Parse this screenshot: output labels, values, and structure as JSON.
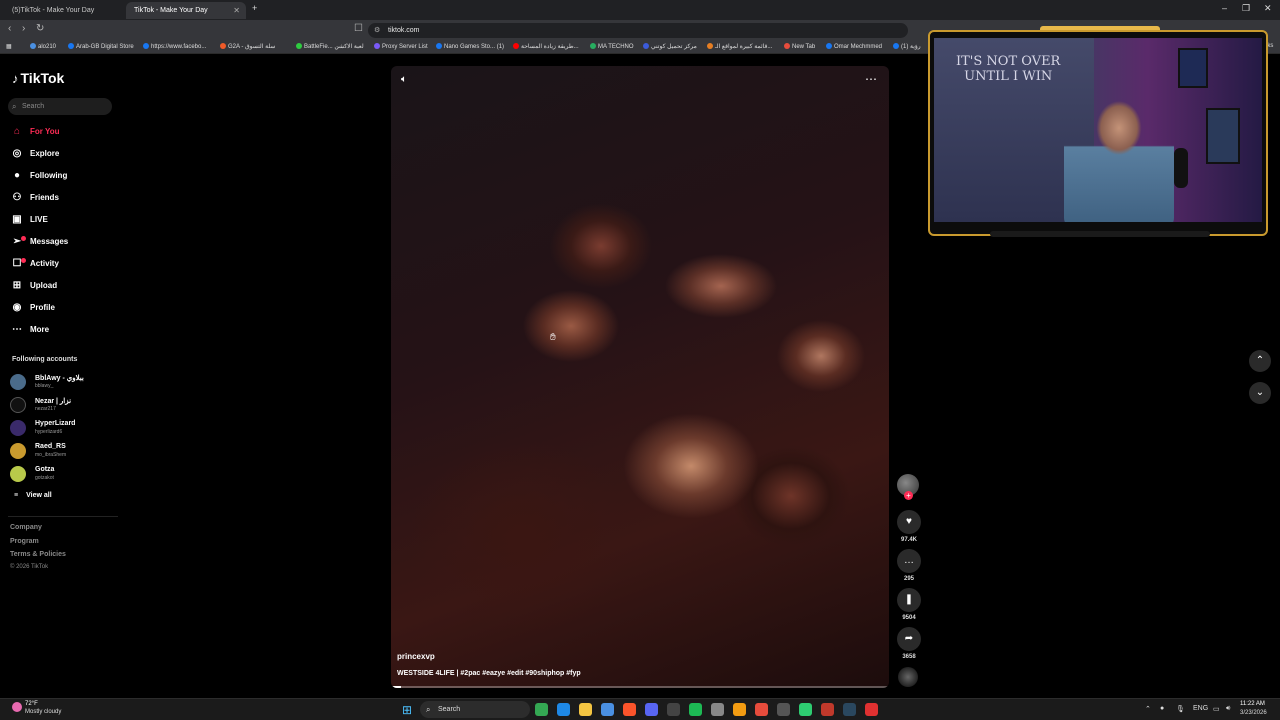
{
  "browser": {
    "tabs": [
      {
        "label": "(5)TikTok - Make Your Day"
      },
      {
        "label": "TikTok - Make Your Day"
      }
    ],
    "new_tab_symbol": "+",
    "url": "tiktok.com",
    "bookmarks": [
      {
        "label": "alo210",
        "color": "#4a90e2"
      },
      {
        "label": "Arab-GB Digital Store",
        "color": "#1877f2"
      },
      {
        "label": "https://www.facebo...",
        "color": "#1877f2"
      },
      {
        "label": "G2A - سلة التسوق",
        "color": "#f05a28"
      },
      {
        "label": "BattleFie... لعبة الاكشن",
        "color": "#2ecc40"
      },
      {
        "label": "Proxy Server List",
        "color": "#7a5af8"
      },
      {
        "label": "Nano Games Sto... (1)",
        "color": "#1877f2"
      },
      {
        "label": "طريقة زيادة المساحة...",
        "color": "#ff0000"
      },
      {
        "label": "MA TECHNO",
        "color": "#27ae60"
      },
      {
        "label": "مركز تحميل كوتني",
        "color": "#3b5bdb"
      },
      {
        "label": "قائمة كبيرة لمواقع الـ...",
        "color": "#e67e22"
      },
      {
        "label": "New Tab",
        "color": "#e74c3c"
      },
      {
        "label": "Omar Mechmmed",
        "color": "#1877f2"
      },
      {
        "label": "(1) رؤية",
        "color": "#1877f2"
      }
    ],
    "bookmarks_overflow": "arks"
  },
  "sidebar": {
    "logo": "TikTok",
    "search_placeholder": "Search",
    "nav": [
      {
        "label": "For You",
        "icon": "home-icon",
        "active": true
      },
      {
        "label": "Explore",
        "icon": "compass-icon"
      },
      {
        "label": "Following",
        "icon": "following-icon"
      },
      {
        "label": "Friends",
        "icon": "friends-icon"
      },
      {
        "label": "LIVE",
        "icon": "live-icon"
      },
      {
        "label": "Messages",
        "icon": "messages-icon"
      },
      {
        "label": "Activity",
        "icon": "activity-icon"
      },
      {
        "label": "Upload",
        "icon": "upload-icon"
      },
      {
        "label": "Profile",
        "icon": "profile-icon"
      },
      {
        "label": "More",
        "icon": "more-icon"
      }
    ],
    "following_title": "Following accounts",
    "accounts": [
      {
        "name": "BblAwy - ببلاوي",
        "handle": "bblawy_",
        "color": "#4a6b8a"
      },
      {
        "name": "Nezar | نزار",
        "handle": "nezar217",
        "color": "#111111"
      },
      {
        "name": "HyperLizard",
        "handle": "hyperlizard6",
        "color": "#3a2a6a"
      },
      {
        "name": "Raed_RS",
        "handle": "mo_ibraShem",
        "color": "#c99a2e"
      },
      {
        "name": "Gotza",
        "handle": "gotzakot",
        "color": "#b8c94a"
      }
    ],
    "view_all": "View all",
    "footer": [
      "Company",
      "Program",
      "Terms & Policies",
      "© 2026 TikTok"
    ]
  },
  "video": {
    "author": "princexvp",
    "caption": "WESTSIDE 4LIFE | #2pac #eazye #edit #90shiphop #fyp",
    "progress": 0.02
  },
  "actions": {
    "likes": "97.4K",
    "comments": "295",
    "saves": "9504",
    "shares": "3658"
  },
  "webcam": {
    "poster_text_line1": "IT'S NOT OVER",
    "poster_text_line2": "UNTIL I WIN"
  },
  "taskbar": {
    "weather_temp": "72°F",
    "weather_desc": "Mostly cloudy",
    "search_label": "Search",
    "lang": "ENG",
    "time": "11:22 AM",
    "date": "3/23/2026",
    "apps": [
      {
        "icon": "chrome-icon",
        "color": "#34a853"
      },
      {
        "icon": "edge-icon",
        "color": "#1e88e5"
      },
      {
        "icon": "folder-icon",
        "color": "#f4c542"
      },
      {
        "icon": "store-icon",
        "color": "#4a90e2"
      },
      {
        "icon": "brave-icon",
        "color": "#fb542b"
      },
      {
        "icon": "discord-icon",
        "color": "#5865f2"
      },
      {
        "icon": "obs-icon",
        "color": "#444444"
      },
      {
        "icon": "spotify-icon",
        "color": "#1db954"
      },
      {
        "icon": "settings-icon",
        "color": "#888888"
      },
      {
        "icon": "cloud-icon",
        "color": "#f39c12"
      },
      {
        "icon": "recorder-icon",
        "color": "#e74c3c"
      },
      {
        "icon": "media-icon",
        "color": "#555555"
      },
      {
        "icon": "xbox-icon",
        "color": "#2ecc71"
      },
      {
        "icon": "app-red-icon",
        "color": "#c0392b"
      },
      {
        "icon": "steam-icon",
        "color": "#2a475e"
      },
      {
        "icon": "adobe-icon",
        "color": "#e03131"
      }
    ]
  }
}
